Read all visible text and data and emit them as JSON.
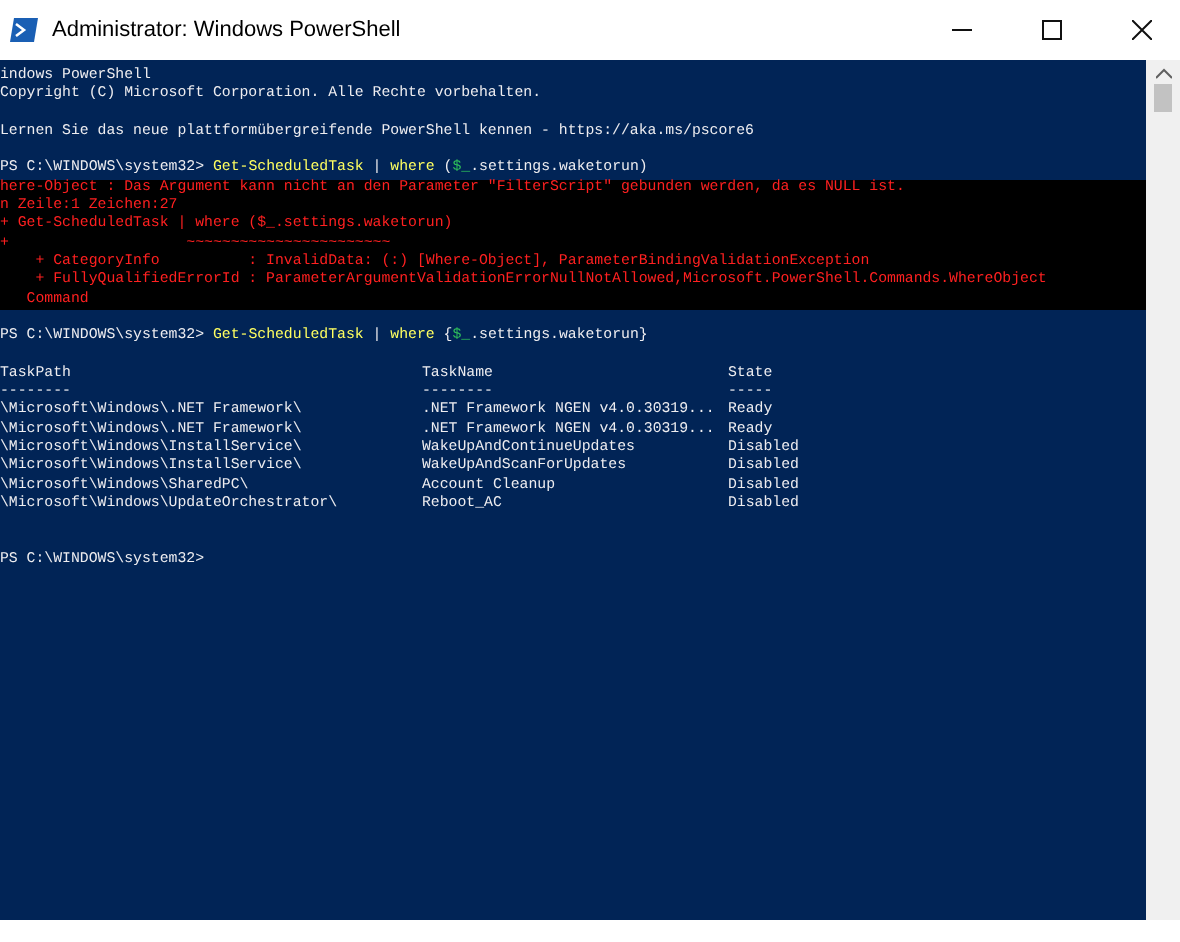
{
  "window": {
    "title": "Administrator: Windows PowerShell"
  },
  "output": [
    {
      "kind": "line",
      "segments": [
        {
          "kind": "plain",
          "text": "indows PowerShell"
        }
      ]
    },
    {
      "kind": "line",
      "segments": [
        {
          "kind": "plain",
          "text": "Copyright (C) Microsoft Corporation. Alle Rechte vorbehalten."
        }
      ]
    },
    {
      "kind": "blank"
    },
    {
      "kind": "line",
      "segments": [
        {
          "kind": "plain",
          "text": "Lernen Sie das neue plattformübergreifende PowerShell kennen - https://aka.ms/pscore6"
        }
      ]
    },
    {
      "kind": "blank"
    },
    {
      "kind": "line",
      "segments": [
        {
          "kind": "plain",
          "text": "PS C:\\WINDOWS\\system32> "
        },
        {
          "kind": "command",
          "text": "Get-ScheduledTask"
        },
        {
          "kind": "plain",
          "text": " | "
        },
        {
          "kind": "command",
          "text": "where"
        },
        {
          "kind": "plain",
          "text": " ("
        },
        {
          "kind": "variable",
          "text": "$_"
        },
        {
          "kind": "plain",
          "text": ".settings.waketorun)"
        }
      ]
    },
    {
      "kind": "error",
      "lines": [
        "here-Object : Das Argument kann nicht an den Parameter \"FilterScript\" gebunden werden, da es NULL ist.",
        "n Zeile:1 Zeichen:27",
        "+ Get-ScheduledTask | where ($_.settings.waketorun)",
        "+                    ~~~~~~~~~~~~~~~~~~~~~~~",
        "    + CategoryInfo          : InvalidData: (:) [Where-Object], ParameterBindingValidationException",
        "    + FullyQualifiedErrorId : ParameterArgumentValidationErrorNullNotAllowed,Microsoft.PowerShell.Commands.WhereObject",
        "   Command"
      ]
    },
    {
      "kind": "blank"
    },
    {
      "kind": "line",
      "segments": [
        {
          "kind": "plain",
          "text": "PS C:\\WINDOWS\\system32> "
        },
        {
          "kind": "command",
          "text": "Get-ScheduledTask"
        },
        {
          "kind": "plain",
          "text": " | "
        },
        {
          "kind": "command",
          "text": "where"
        },
        {
          "kind": "plain",
          "text": " {"
        },
        {
          "kind": "variable",
          "text": "$_"
        },
        {
          "kind": "plain",
          "text": ".settings.waketorun}"
        }
      ]
    },
    {
      "kind": "blank"
    },
    {
      "kind": "table",
      "columns": [
        {
          "header": "TaskPath",
          "rule": "--------"
        },
        {
          "header": "TaskName",
          "rule": "--------"
        },
        {
          "header": "State",
          "rule": "-----"
        }
      ],
      "rows": [
        [
          "\\Microsoft\\Windows\\.NET Framework\\",
          ".NET Framework NGEN v4.0.30319...",
          "Ready"
        ],
        [
          "\\Microsoft\\Windows\\.NET Framework\\",
          ".NET Framework NGEN v4.0.30319...",
          "Ready"
        ],
        [
          "\\Microsoft\\Windows\\InstallService\\",
          "WakeUpAndContinueUpdates",
          "Disabled"
        ],
        [
          "\\Microsoft\\Windows\\InstallService\\",
          "WakeUpAndScanForUpdates",
          "Disabled"
        ],
        [
          "\\Microsoft\\Windows\\SharedPC\\",
          "Account Cleanup",
          "Disabled"
        ],
        [
          "\\Microsoft\\Windows\\UpdateOrchestrator\\",
          "Reboot_AC",
          "Disabled"
        ]
      ]
    },
    {
      "kind": "blank"
    },
    {
      "kind": "blank"
    },
    {
      "kind": "line",
      "segments": [
        {
          "kind": "plain",
          "text": "PS C:\\WINDOWS\\system32>"
        }
      ]
    }
  ]
}
